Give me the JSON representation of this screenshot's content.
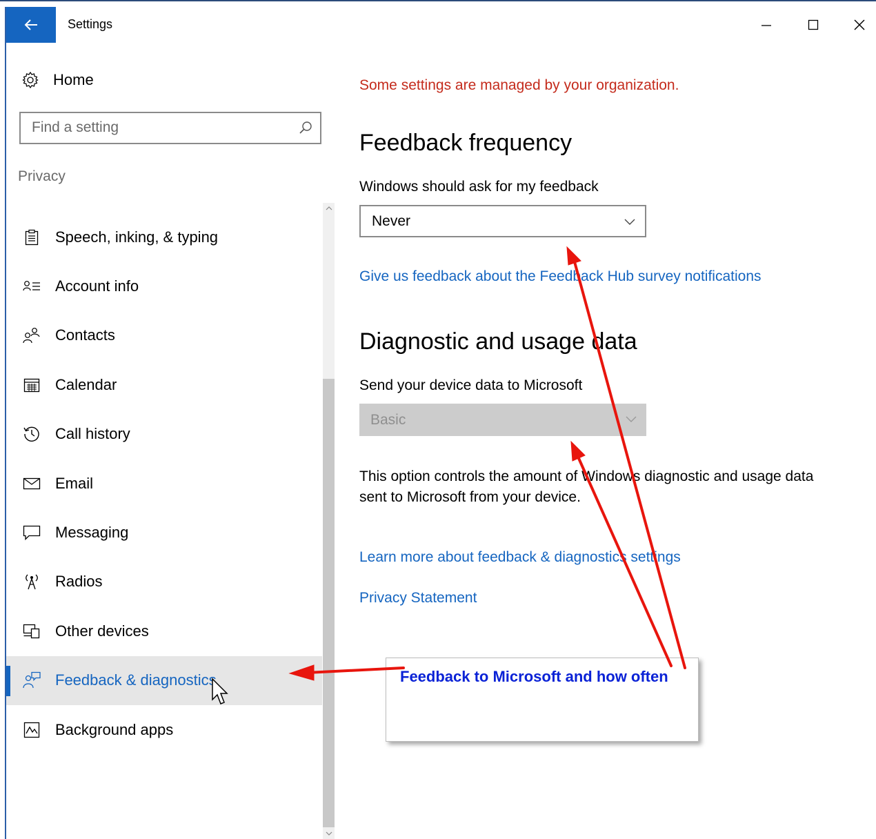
{
  "window": {
    "title": "Settings",
    "controls": {
      "minimize": "minimize",
      "maximize": "maximize",
      "close": "close"
    }
  },
  "sidebar": {
    "home_label": "Home",
    "search_placeholder": "Find a setting",
    "section_label": "Privacy",
    "items": [
      {
        "label": "Speech, inking, & typing",
        "icon": "clipboard-icon"
      },
      {
        "label": "Account info",
        "icon": "account-info-icon"
      },
      {
        "label": "Contacts",
        "icon": "contacts-icon"
      },
      {
        "label": "Calendar",
        "icon": "calendar-icon"
      },
      {
        "label": "Call history",
        "icon": "history-icon"
      },
      {
        "label": "Email",
        "icon": "envelope-icon"
      },
      {
        "label": "Messaging",
        "icon": "chat-bubble-icon"
      },
      {
        "label": "Radios",
        "icon": "antenna-icon"
      },
      {
        "label": "Other devices",
        "icon": "devices-icon"
      },
      {
        "label": "Feedback & diagnostics",
        "icon": "feedback-icon",
        "selected": true
      },
      {
        "label": "Background apps",
        "icon": "background-apps-icon"
      }
    ]
  },
  "main": {
    "managed_notice": "Some settings are managed by your organization.",
    "feedback": {
      "heading": "Feedback frequency",
      "label": "Windows should ask for my feedback",
      "value": "Never",
      "link": "Give us feedback about the Feedback Hub survey notifications"
    },
    "diagnostics": {
      "heading": "Diagnostic and usage data",
      "label": "Send your device data to Microsoft",
      "value": "Basic",
      "description": "This option controls the amount of Windows diagnostic and usage data sent to Microsoft from your device."
    },
    "links": {
      "learn_more": "Learn more about feedback & diagnostics settings",
      "privacy": "Privacy Statement"
    }
  },
  "annotation": {
    "callout_text": "Feedback to Microsoft and how often",
    "arrow_color": "#e8150d",
    "text_color": "#0a22d6"
  },
  "colors": {
    "accent": "#1565c0",
    "warning": "#c42b1c",
    "selected_bg": "#e6e6e6"
  }
}
